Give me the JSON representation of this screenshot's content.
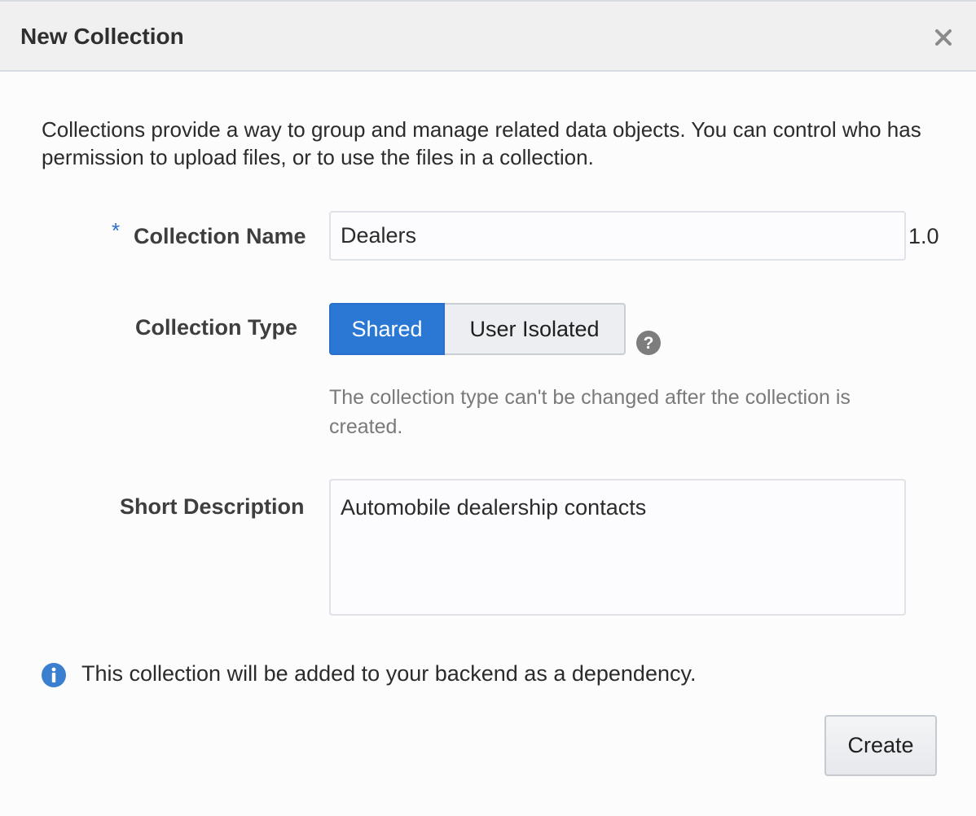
{
  "dialog": {
    "title": "New Collection",
    "close_icon": "close-icon"
  },
  "intro": {
    "text": "Collections provide a way to group and manage related data objects. You can control who has permission to upload files, or to use the files in a collection."
  },
  "form": {
    "name": {
      "required_marker": "*",
      "label": "Collection Name",
      "value": "Dealers",
      "version": "1.0"
    },
    "type": {
      "label": "Collection Type",
      "options": [
        "Shared",
        "User Isolated"
      ],
      "selected": "Shared",
      "help_icon": "question-circle-icon",
      "note": "The collection type can't be changed after the collection is created."
    },
    "description": {
      "label": "Short Description",
      "value": "Automobile dealership contacts"
    }
  },
  "info": {
    "icon": "info-circle-icon",
    "text": "This collection will be added to your backend as a dependency."
  },
  "footer": {
    "create_label": "Create"
  },
  "colors": {
    "accent": "#2a78d4",
    "header_bg": "#f0f0f0",
    "info_icon": "#3a7fd0",
    "help_icon": "#7d7d7d"
  }
}
